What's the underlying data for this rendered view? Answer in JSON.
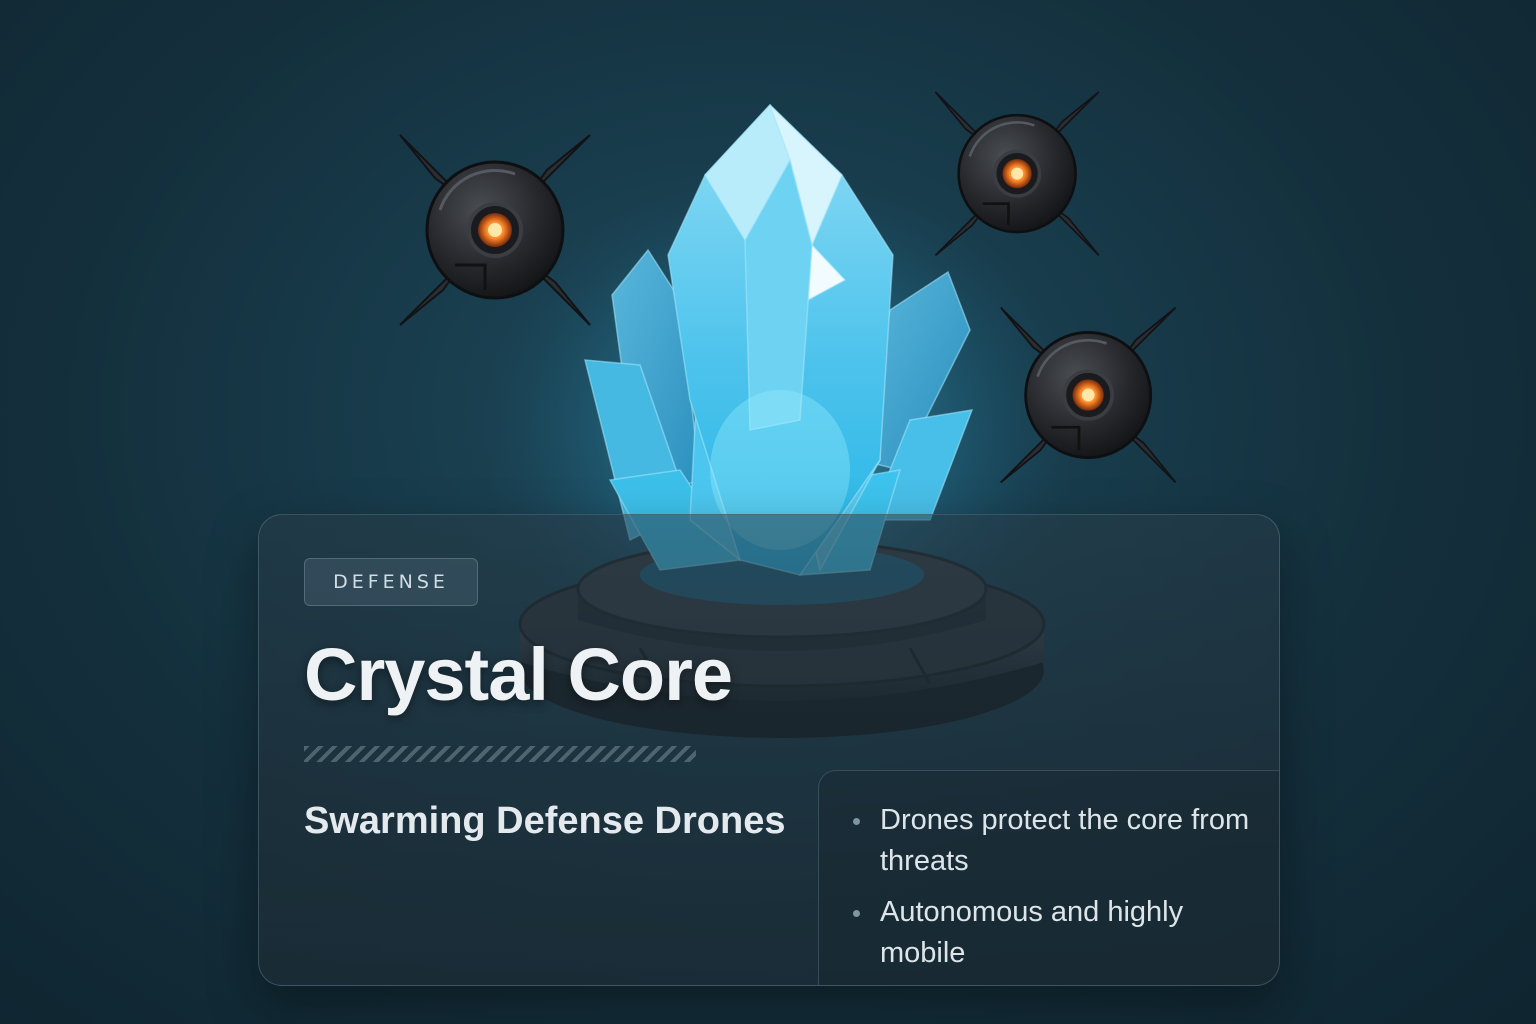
{
  "card": {
    "tag": "DEFENSE",
    "title": "Crystal Core",
    "subtitle": "Swarming Defense Drones",
    "bullets": [
      "Drones protect the core from threats",
      "Autonomous and highly mobile"
    ]
  },
  "scene": {
    "crystal_icon": "crystal-icon",
    "pedestal_icon": "pedestal-icon",
    "drone_icon": "drone-icon",
    "drone_count": 3,
    "colors": {
      "crystal": "#3fc4ee",
      "drone_eye": "#ff8a2a",
      "background": "#173847"
    }
  }
}
